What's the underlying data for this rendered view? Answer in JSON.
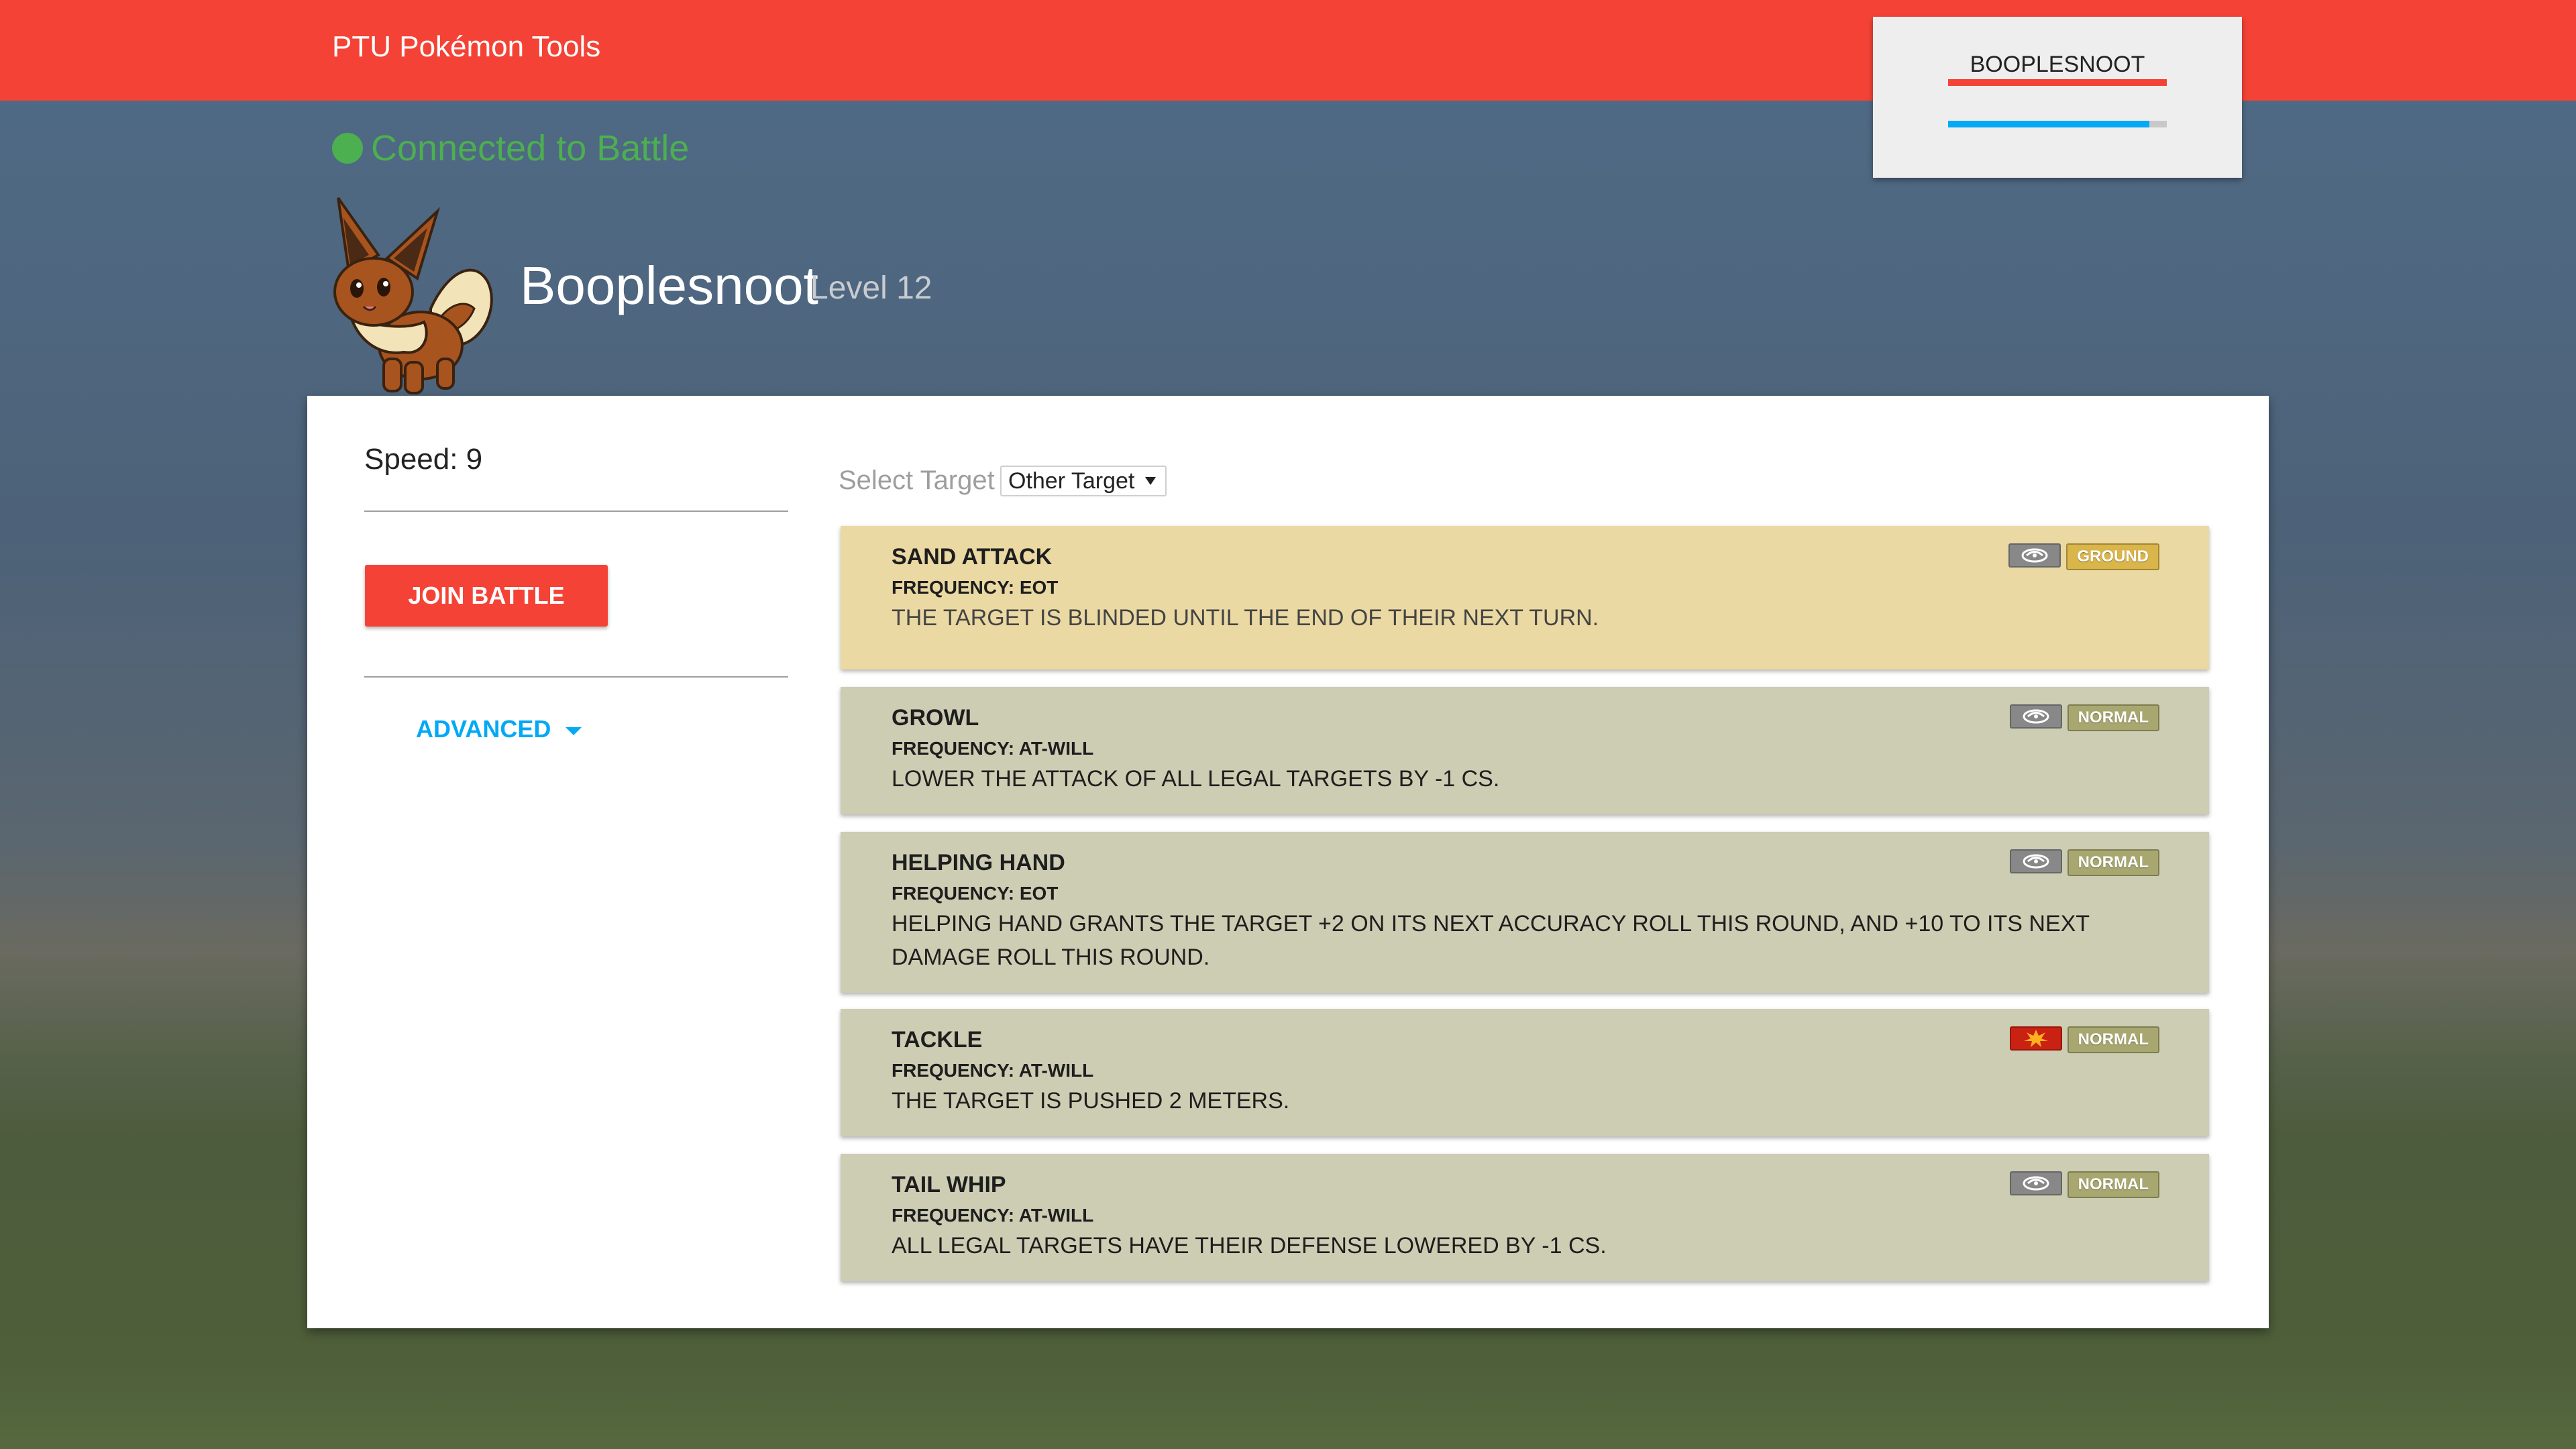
{
  "app": {
    "title": "PTU Pokémon Tools"
  },
  "hp_card": {
    "name": "BOOPLESNOOT",
    "hp_fraction": 1.0,
    "exp_fraction": 0.92
  },
  "status": {
    "text": "Connected to Battle",
    "color": "#4caf50"
  },
  "pokemon": {
    "name": "Booplesnoot",
    "level": "Level 12"
  },
  "left": {
    "speed": "Speed: 9",
    "join_label": "JOIN BATTLE",
    "advanced_label": "ADVANCED"
  },
  "target": {
    "label": "Select Target",
    "selected": "Other Target"
  },
  "moves": [
    {
      "name": "SAND ATTACK",
      "frequency": "FREQUENCY: EOT",
      "description": "The target is blinded until the end of their next turn.",
      "category": "status-icon",
      "type": "GROUND",
      "bg": "#ebd9a3",
      "type_color": "#d9b54a",
      "cat_color": "#888888"
    },
    {
      "name": "GROWL",
      "frequency": "FREQUENCY: AT-WILL",
      "description": "Lower the Attack of all legal targets by -1 CS.",
      "category": "status-icon",
      "type": "NORMAL",
      "bg": "#cdcdb4",
      "type_color": "#a7a76f",
      "cat_color": "#888888"
    },
    {
      "name": "HELPING HAND",
      "frequency": "FREQUENCY: EOT",
      "description": "Helping Hand grants the target +2 on its next Accuracy Roll this round, and +10 to its next Damage Roll this round.",
      "category": "status-icon",
      "type": "NORMAL",
      "bg": "#cdcdb4",
      "type_color": "#a7a76f",
      "cat_color": "#888888"
    },
    {
      "name": "TACKLE",
      "frequency": "FREQUENCY: AT-WILL",
      "description": "The target is pushed 2 meters.",
      "category": "physical-icon",
      "type": "NORMAL",
      "bg": "#cdcdb4",
      "type_color": "#a7a76f",
      "cat_color": "#c92112"
    },
    {
      "name": "TAIL WHIP",
      "frequency": "FREQUENCY: AT-WILL",
      "description": "All legal targets have their Defense lowered by -1 CS.",
      "category": "status-icon",
      "type": "NORMAL",
      "bg": "#cdcdb4",
      "type_color": "#a7a76f",
      "cat_color": "#888888"
    }
  ]
}
